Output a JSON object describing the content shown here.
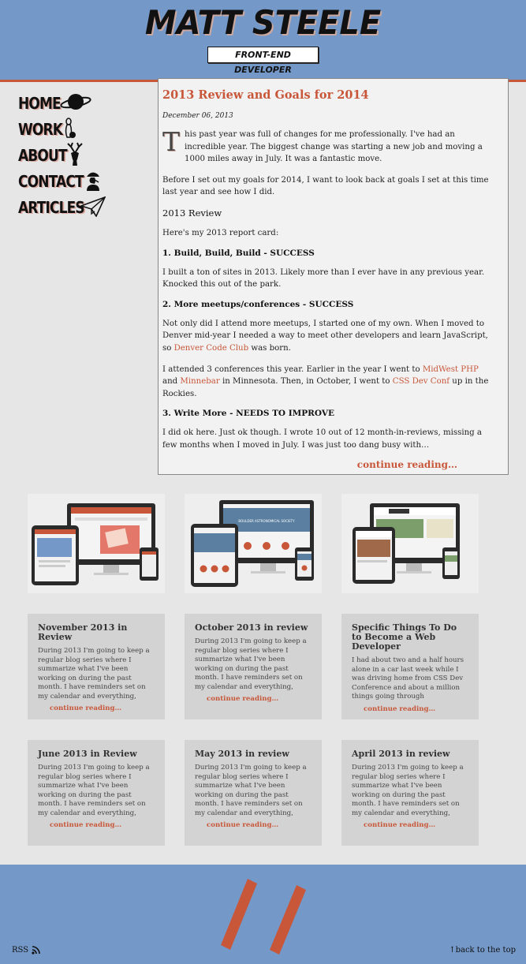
{
  "header": {
    "title": "MATT STEELE",
    "subtitle": "FRONT-END DEVELOPER"
  },
  "nav": [
    {
      "label": "HOME",
      "icon": "planet-icon"
    },
    {
      "label": "WORK",
      "icon": "bowling-pin-icon"
    },
    {
      "label": "ABOUT",
      "icon": "deer-icon"
    },
    {
      "label": "CONTACT",
      "icon": "detective-icon"
    },
    {
      "label": "ARTICLES",
      "icon": "paper-plane-icon"
    }
  ],
  "featured": {
    "title": "2013 Review and Goals for 2014",
    "date": "December 06, 2013",
    "dropcap": "T",
    "intro_rest": "his past year was full of changes for me professionally. I've had an incredible year. The biggest change was starting a new job and moving a 1000 miles away in July. It was a fantastic move.",
    "p2": "Before I set out my goals for 2014, I want to look back at goals I set at this time last year and see how I did.",
    "h_review": "2013 Review",
    "p3": "Here's my 2013 report card:",
    "goal1": "1. Build, Build, Build - SUCCESS",
    "p4": "I built a ton of sites in 2013. Likely more than I ever have in any previous year. Knocked this out of the park.",
    "goal2": "2. More meetups/conferences - SUCCESS",
    "p5_a": "Not only did I attend more meetups, I started one of my own. When I moved to Denver mid-year I needed a way to meet other developers and learn JavaScript, so ",
    "p5_link": "Denver Code Club",
    "p5_b": " was born.",
    "p6_a": "I attended 3 conferences this year. Earlier in the year I went to ",
    "p6_link1": "MidWest PHP",
    "p6_and": " and ",
    "p6_link2": "Minnebar",
    "p6_b": " in Minnesota. Then, in October, I went to ",
    "p6_link3": "CSS Dev Conf",
    "p6_c": " up in the Rockies.",
    "goal3": "3. Write More - NEEDS TO IMPROVE",
    "p7": "I did ok here. Just ok though. I wrote 10 out of 12 month-in-reviews, missing a few months when I moved in July. I was just too dang busy with…",
    "continue": "continue reading…"
  },
  "thumbnails": [
    {
      "alt": "responsive site mockup 1",
      "screen_color": "#e2776a"
    },
    {
      "alt": "responsive site mockup 2",
      "screen_color": "#5a7fa0"
    },
    {
      "alt": "responsive site mockup 3",
      "screen_color": "#7b9e6b"
    }
  ],
  "thumb_text": {
    "label": "BOULDER ASTRONOMICAL SOCIETY"
  },
  "cards": [
    {
      "title": "November 2013 in Review",
      "excerpt": "During 2013 I'm going to keep a regular blog series where I summarize what I've been working on during the past month. I have reminders set on my calendar and everything,",
      "more": "continue reading…"
    },
    {
      "title": "October 2013 in review",
      "excerpt": "During 2013 I'm going to keep a regular blog series where I summarize what I've been working on during the past month. I have reminders set on my calendar and everything,",
      "more": "continue reading…"
    },
    {
      "title": "Specific Things To Do to Become a Web Developer",
      "excerpt": "I had about two and a half hours alone in a car last week while I was driving home from CSS Dev Conference and about a million things going through",
      "more": "continue reading…"
    },
    {
      "title": "June 2013 in Review",
      "excerpt": "During 2013 I'm going to keep a regular blog series where I summarize what I've been working on during the past month. I have reminders set on my calendar and everything,",
      "more": "continue reading…"
    },
    {
      "title": "May 2013 in review",
      "excerpt": "During 2013 I'm going to keep a regular blog series where I summarize what I've been working on during the past month. I have reminders set on my calendar and everything,",
      "more": "continue reading…"
    },
    {
      "title": "April 2013 in review",
      "excerpt": "During 2013 I'm going to keep a regular blog series where I summarize what I've been working on during the past month. I have reminders set on my calendar and everything,",
      "more": "continue reading…"
    }
  ],
  "footer": {
    "rss": "RSS",
    "back_to_top": "↑back to the top"
  },
  "colors": {
    "accent": "#c8573a",
    "header_bg": "#7498c8",
    "page_bg": "#e6e6e6",
    "card_bg": "#d3d3d3"
  }
}
